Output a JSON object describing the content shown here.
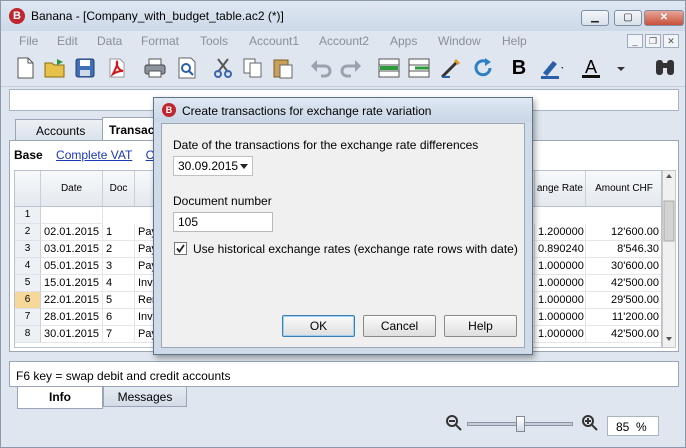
{
  "window": {
    "title": "Banana - [Company_with_budget_table.ac2 (*)]",
    "logo_letter": "B",
    "buttons": {
      "minimize": "▁",
      "maximize": "▢",
      "close": "✕"
    }
  },
  "menu": [
    "File",
    "Edit",
    "Data",
    "Format",
    "Tools",
    "Account1",
    "Account2",
    "Apps",
    "Window",
    "Help"
  ],
  "mdi_buttons": {
    "minimize": "_",
    "restore": "❐",
    "close": "✕"
  },
  "toolbar": {
    "icons": [
      "new-file-icon",
      "open-file-icon",
      "save-icon",
      "pdf-icon",
      "print-icon",
      "print-preview-icon",
      "cut-icon",
      "copy-icon",
      "paste-icon",
      "undo-icon",
      "redo-icon",
      "insert-rows-icon",
      "delete-rows-icon",
      "recheck-accounting-icon",
      "refresh-icon",
      "bold-icon",
      "highlight-icon",
      "font-color-icon",
      "find-icon"
    ],
    "bold_label": "B",
    "font_label": "A"
  },
  "tabs": {
    "accounts": "Accounts",
    "transactions": "Transac"
  },
  "views": {
    "base": "Base",
    "complete_vat": "Complete VAT",
    "cost": "Cost"
  },
  "grid": {
    "headers": {
      "date": "Date",
      "doc": "Doc",
      "exchange_rate": "ange Rate",
      "amount_chf": "Amount CHF"
    },
    "rows": [
      {
        "n": "1",
        "date": "",
        "doc": "",
        "desc": "",
        "rate": "",
        "amount": ""
      },
      {
        "n": "2",
        "date": "02.01.2015",
        "doc": "1",
        "desc": "Pay",
        "rate": "1.200000",
        "amount": "12'600.00"
      },
      {
        "n": "3",
        "date": "03.01.2015",
        "doc": "2",
        "desc": "Pay",
        "rate": "0.890240",
        "amount": "8'546.30"
      },
      {
        "n": "4",
        "date": "05.01.2015",
        "doc": "3",
        "desc": "Pay",
        "rate": "1.000000",
        "amount": "30'600.00"
      },
      {
        "n": "5",
        "date": "15.01.2015",
        "doc": "4",
        "desc": "Invo",
        "rate": "1.000000",
        "amount": "42'500.00"
      },
      {
        "n": "6",
        "date": "22.01.2015",
        "doc": "5",
        "desc": "Ren",
        "rate": "1.000000",
        "amount": "29'500.00"
      },
      {
        "n": "7",
        "date": "28.01.2015",
        "doc": "6",
        "desc": "Invo",
        "rate": "1.000000",
        "amount": "11'200.00"
      },
      {
        "n": "8",
        "date": "30.01.2015",
        "doc": "7",
        "desc": "Pay",
        "rate": "1.000000",
        "amount": "42'500.00"
      }
    ]
  },
  "info": {
    "text": "F6 key = swap debit and credit accounts"
  },
  "bottom_tabs": {
    "info": "Info",
    "messages": "Messages"
  },
  "zoom": {
    "value": "85",
    "unit": "%",
    "level": 0.5
  },
  "dialog": {
    "title": "Create transactions for exchange rate variation",
    "date_label": "Date of the transactions for the exchange rate differences",
    "date_value": "30.09.2015",
    "docnum_label": "Document number",
    "docnum_value": "105",
    "historical_label": "Use historical exchange rates (exchange rate rows with date)",
    "historical_checked": true,
    "ok": "OK",
    "cancel": "Cancel",
    "help": "Help"
  }
}
